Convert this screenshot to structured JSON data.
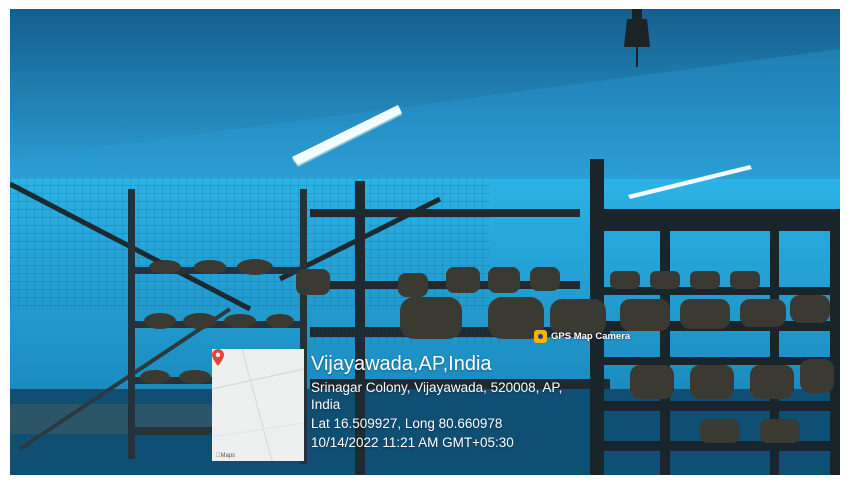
{
  "badge": {
    "label": "GPS Map Camera",
    "icon": "gps-map-camera-logo-icon"
  },
  "map": {
    "credit": "Maps",
    "pin_icon": "location-pin-icon",
    "pin_color": "#e0463a"
  },
  "location": {
    "title": "Vijayawada,AP,India",
    "address_line1": "Srinagar Colony, Vijayawada, 520008, AP,",
    "address_line2": "India",
    "coordinates": "Lat 16.509927, Long 80.660978",
    "timestamp": "10/14/2022 11:21 AM GMT+05:30"
  },
  "colors": {
    "shade_net": "#1e9fd6",
    "overlay": "#2e3438",
    "badge_accent": "#f4b400"
  }
}
